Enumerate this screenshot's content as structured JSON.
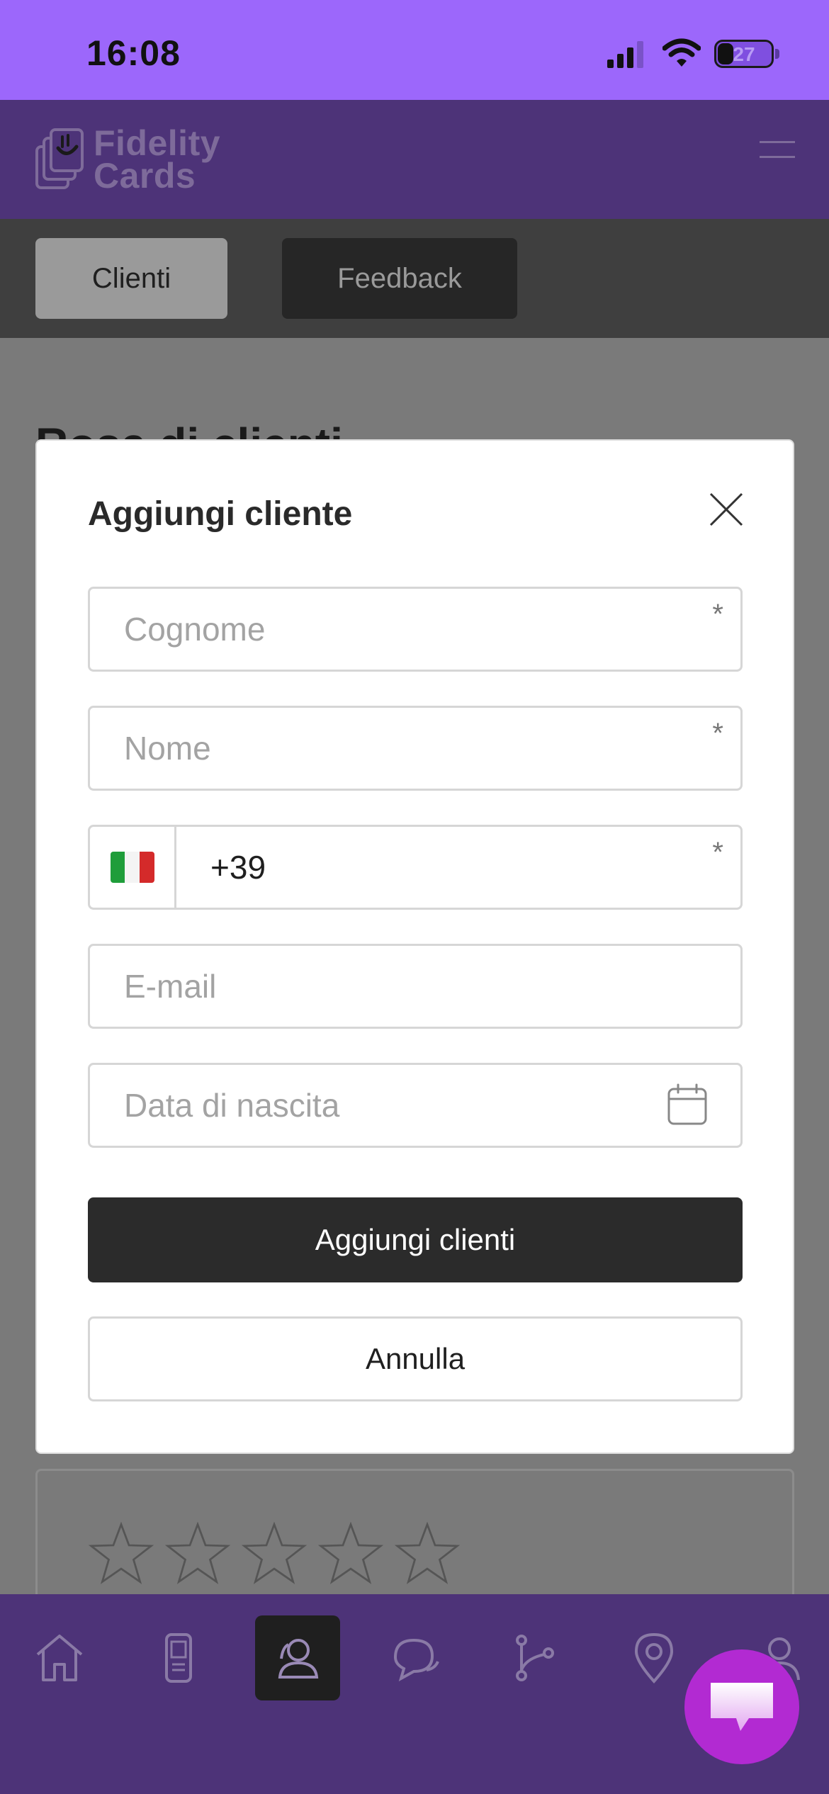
{
  "status_bar": {
    "time": "16:08",
    "battery": "27"
  },
  "header": {
    "logo_line1": "Fidelity",
    "logo_line2": "Cards"
  },
  "tabs": [
    {
      "label": "Clienti"
    },
    {
      "label": "Feedback"
    }
  ],
  "background": {
    "page_title": "Rosa di clienti"
  },
  "modal": {
    "title": "Aggiungi cliente",
    "fields": {
      "surname_placeholder": "Cognome",
      "name_placeholder": "Nome",
      "phone_value": "+39",
      "email_placeholder": "E-mail",
      "birthdate_placeholder": "Data di nascita",
      "required_mark": "*"
    },
    "submit_label": "Aggiungi clienti",
    "cancel_label": "Annulla"
  },
  "colors": {
    "status_bar": "#9c67fb",
    "brand_dimmed": "#4d3378",
    "fab": "#b22ad2",
    "primary_button": "#2b2b2b"
  },
  "rating": {
    "filled": 0,
    "max": 5
  },
  "bottom_nav": {
    "items": [
      "home-icon",
      "device-icon",
      "clients-icon",
      "chat-icon",
      "flow-icon",
      "location-icon",
      "profile-icon"
    ],
    "active": "clients-icon"
  }
}
